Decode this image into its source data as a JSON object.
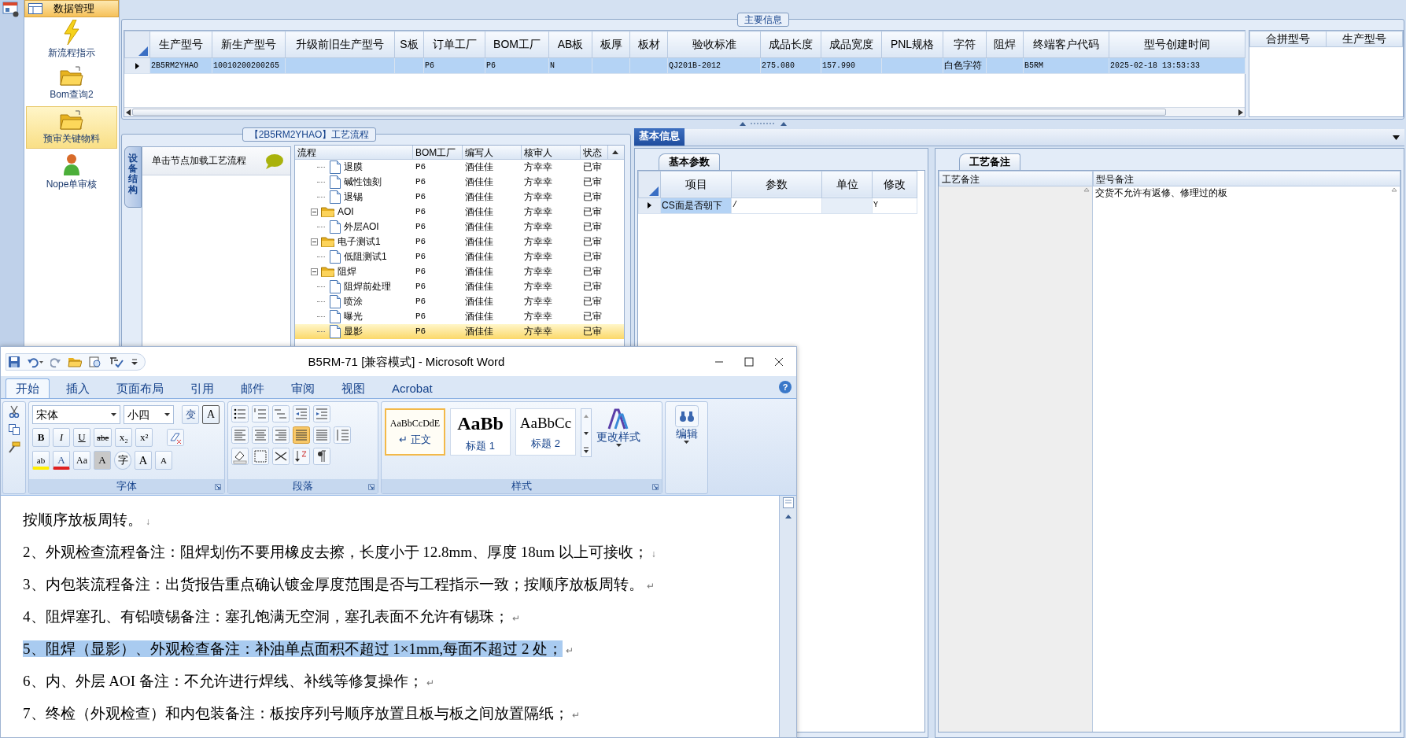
{
  "app": {
    "sidebar": {
      "header": "数据管理",
      "items": [
        {
          "label": "新流程指示",
          "kind": "lightning",
          "selected": false
        },
        {
          "label": "Bom查询2",
          "kind": "folder",
          "selected": false
        },
        {
          "label": "预审关键物料",
          "kind": "folder",
          "selected": true
        },
        {
          "label": "Nope单审核",
          "kind": "person",
          "selected": false
        }
      ]
    },
    "main_info": {
      "title": "主要信息",
      "columns": [
        "生产型号",
        "新生产型号",
        "升级前旧生产型号",
        "S板",
        "订单工厂",
        "BOM工厂",
        "AB板",
        "板厚",
        "板材",
        "验收标准",
        "成品长度",
        "成品宽度",
        "PNL规格",
        "字符",
        "阻焊",
        "终端客户代码",
        "型号创建时间"
      ],
      "rows": [
        {
          "selected": true,
          "cells": [
            "2B5RM2YHAO",
            "10010200200265",
            null,
            null,
            "P6",
            "P6",
            "N",
            null,
            null,
            "QJ201B-2012",
            "275.080",
            "157.990",
            null,
            "白色字符",
            null,
            "B5RM",
            "2025-02-18 13:53:33"
          ]
        }
      ],
      "side_columns": [
        "合拼型号",
        "生产型号"
      ]
    },
    "process": {
      "title": "【2B5RM2YHAO】工艺流程",
      "side_tab": "设备结构",
      "hint": "单击节点加载工艺流程",
      "columns": [
        "流程",
        "BOM工厂",
        "编写人",
        "核审人",
        "状态"
      ],
      "continued": [
        {
          "label": "退膜",
          "bom_factory": "P6",
          "writer": "酒佳佳",
          "reviewer": "方幸幸",
          "status": "已审",
          "selected": false
        },
        {
          "label": "碱性蚀刻",
          "bom_factory": "P6",
          "writer": "酒佳佳",
          "reviewer": "方幸幸",
          "status": "已审",
          "selected": false
        },
        {
          "label": "退锡",
          "bom_factory": "P6",
          "writer": "酒佳佳",
          "reviewer": "方幸幸",
          "status": "已审",
          "selected": false
        }
      ],
      "groups": [
        {
          "label": "AOI",
          "bom_factory": "P6",
          "writer": "酒佳佳",
          "reviewer": "方幸幸",
          "status": "已审",
          "selected": false,
          "expanded": true,
          "children": [
            {
              "label": "外层AOI",
              "bom_factory": "P6",
              "writer": "酒佳佳",
              "reviewer": "方幸幸",
              "status": "已审",
              "selected": false
            }
          ]
        },
        {
          "label": "电子测试1",
          "bom_factory": "P6",
          "writer": "酒佳佳",
          "reviewer": "方幸幸",
          "status": "已审",
          "selected": false,
          "expanded": true,
          "children": [
            {
              "label": "低阻测试1",
              "bom_factory": "P6",
              "writer": "酒佳佳",
              "reviewer": "方幸幸",
              "status": "已审",
              "selected": false
            }
          ]
        },
        {
          "label": "阻焊",
          "bom_factory": "P6",
          "writer": "酒佳佳",
          "reviewer": "方幸幸",
          "status": "已审",
          "selected": false,
          "expanded": true,
          "children": [
            {
              "label": "阻焊前处理",
              "bom_factory": "P6",
              "writer": "酒佳佳",
              "reviewer": "方幸幸",
              "status": "已审",
              "selected": false
            },
            {
              "label": "喷涂",
              "bom_factory": "P6",
              "writer": "酒佳佳",
              "reviewer": "方幸幸",
              "status": "已审",
              "selected": false
            },
            {
              "label": "曝光",
              "bom_factory": "P6",
              "writer": "酒佳佳",
              "reviewer": "方幸幸",
              "status": "已审",
              "selected": false
            },
            {
              "label": "显影",
              "bom_factory": "P6",
              "writer": "酒佳佳",
              "reviewer": "方幸幸",
              "status": "已审",
              "selected": true
            }
          ]
        }
      ]
    },
    "info": {
      "tab": "基本信息",
      "params": {
        "tab": "基本参数",
        "columns": [
          "项目",
          "参数",
          "单位",
          "修改"
        ],
        "rows": [
          [
            "CS面是否朝下",
            "/",
            null,
            "Y"
          ]
        ]
      },
      "notes": {
        "tab": "工艺备注",
        "columns": [
          "工艺备注",
          "型号备注"
        ],
        "rows": [
          [
            null,
            "交货不允许有返修、修理过的板"
          ]
        ]
      }
    }
  },
  "word": {
    "title": "B5RM-71 [兼容模式] - Microsoft Word",
    "tabs": [
      {
        "label": "开始",
        "selected": true
      },
      {
        "label": "插入",
        "selected": false
      },
      {
        "label": "页面布局",
        "selected": false
      },
      {
        "label": "引用",
        "selected": false
      },
      {
        "label": "邮件",
        "selected": false
      },
      {
        "label": "审阅",
        "selected": false
      },
      {
        "label": "视图",
        "selected": false
      },
      {
        "label": "Acrobat",
        "selected": false
      }
    ],
    "help": "?",
    "font": {
      "name": "宋体",
      "size": "小四"
    },
    "font_top": [
      {
        "kind": "phonetic",
        "label": "变"
      },
      {
        "kind": "border",
        "label": "A"
      }
    ],
    "font_rows": [
      [
        {
          "kind": "bold",
          "label": "B"
        },
        {
          "kind": "italic",
          "label": "I"
        },
        {
          "kind": "underline",
          "label": "U"
        },
        {
          "kind": "strike",
          "label": "abe"
        },
        {
          "kind": "sub",
          "label": "x₂"
        },
        {
          "kind": "sup",
          "label": "x²"
        }
      ],
      [
        {
          "kind": "highlight",
          "label": "ab"
        },
        {
          "kind": "color",
          "label": "A"
        },
        {
          "kind": "case",
          "label": "Aa"
        },
        {
          "kind": "shade",
          "label": "A"
        },
        {
          "kind": "enclose",
          "label": "字"
        },
        {
          "kind": "grow",
          "label": "A"
        },
        {
          "kind": "shrink",
          "label": "A"
        }
      ]
    ],
    "align": [
      {
        "kind": "left",
        "selected": false
      },
      {
        "kind": "center",
        "selected": false
      },
      {
        "kind": "right",
        "selected": false
      },
      {
        "kind": "justify",
        "selected": true
      },
      {
        "kind": "distribute",
        "selected": false
      }
    ],
    "group_labels": [
      "字体",
      "段落",
      "样式"
    ],
    "styles": [
      {
        "preview": "AaBbCcDdE",
        "label": "↵ 正文",
        "kind": "normal",
        "selected": true
      },
      {
        "preview": "AaBb",
        "label": "标题 1",
        "kind": "h1",
        "selected": false
      },
      {
        "preview": "AaBbCc",
        "label": "标题 2",
        "kind": "h2",
        "selected": false
      }
    ],
    "change_styles": "更改样式",
    "editing": "编辑",
    "paragraphs": [
      {
        "text": "按顺序放板周转。",
        "mark": "↓",
        "selected": false
      },
      {
        "text": "2、外观检查流程备注：阻焊划伤不要用橡皮去擦，长度小于 12.8mm、厚度 18um 以上可接收；",
        "mark": "↓",
        "selected": false
      },
      {
        "text": "3、内包装流程备注：出货报告重点确认镀金厚度范围是否与工程指示一致；按顺序放板周转。",
        "mark": "↵",
        "selected": false
      },
      {
        "text": "4、阻焊塞孔、有铅喷锡备注：塞孔饱满无空洞，塞孔表面不允许有锡珠；",
        "mark": "↵",
        "selected": false
      },
      {
        "text": "5、阻焊（显影）、外观检查备注：补油单点面积不超过 1×1mm,每面不超过 2 处；",
        "mark": "↵",
        "selected": true
      },
      {
        "text": "6、内、外层 AOI 备注：不允许进行焊线、补线等修复操作；",
        "mark": "↵",
        "selected": false
      },
      {
        "text": "7、终检（外观检查）和内包装备注：板按序列号顺序放置且板与板之间放置隔纸；",
        "mark": "↵",
        "selected": false
      }
    ]
  }
}
